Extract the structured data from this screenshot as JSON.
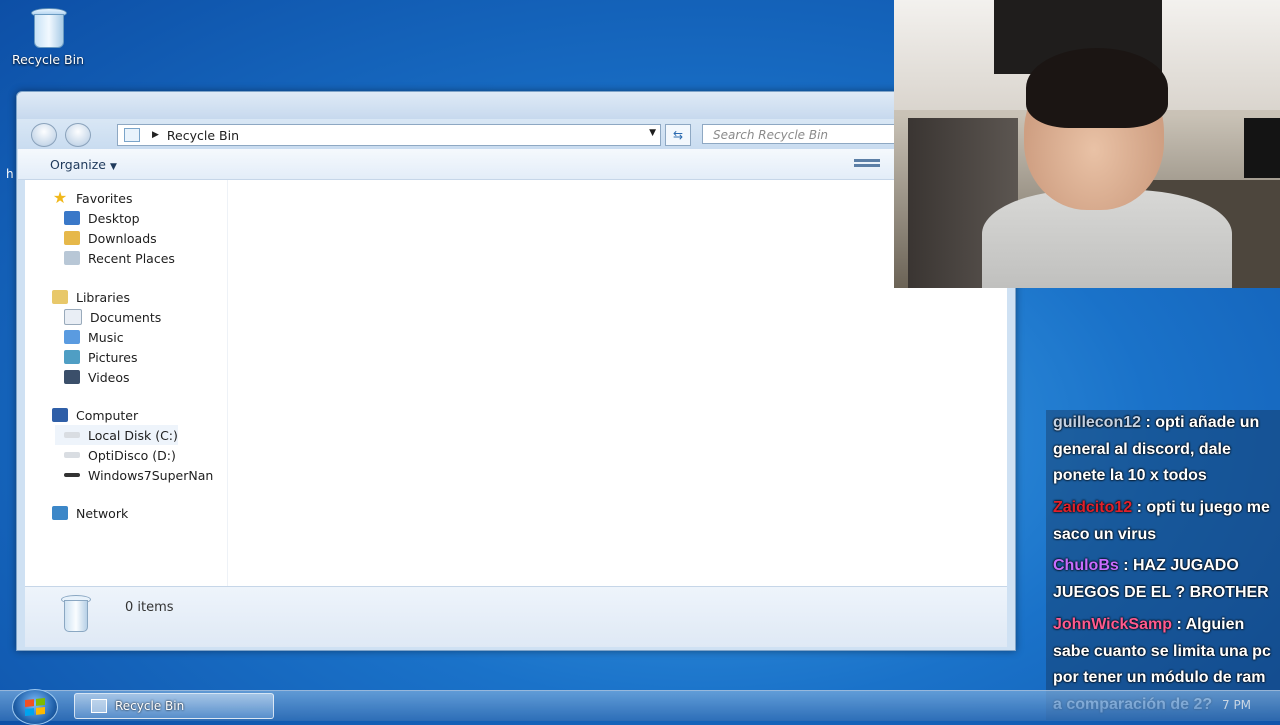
{
  "desktop": {
    "recycle_bin_label": "Recycle Bin",
    "edge_text": "h"
  },
  "window": {
    "address_path": "Recycle Bin",
    "search_placeholder": "Search Recycle Bin",
    "toolbar": {
      "organize_label": "Organize"
    },
    "nav": {
      "favorites": {
        "label": "Favorites",
        "items": [
          "Desktop",
          "Downloads",
          "Recent Places"
        ]
      },
      "libraries": {
        "label": "Libraries",
        "items": [
          "Documents",
          "Music",
          "Pictures",
          "Videos"
        ]
      },
      "computer": {
        "label": "Computer",
        "items": [
          "Local Disk (C:)",
          "OptiDisco (D:)",
          "Windows7SuperNan"
        ]
      },
      "network": {
        "label": "Network"
      }
    },
    "status": {
      "item_count": "0 items"
    }
  },
  "chat": {
    "messages": [
      {
        "user": "guillecon12",
        "user_color": "#c4d2e4",
        "text": "opti añade un general al discord, dale ponete la 10 x todos"
      },
      {
        "user": "Zaidcito12",
        "user_color": "#e0202a",
        "text": "opti tu juego me saco un virus"
      },
      {
        "user": "ChuloBs",
        "user_color": "#c86dff",
        "text": "HAZ JUGADO JUEGOS DE EL ? BROTHER"
      },
      {
        "user": "JohnWickSamp",
        "user_color": "#ff5a8e",
        "text": "Alguien sabe cuanto se limita una pc por tener un módulo de ram a comparación de 2?"
      }
    ]
  },
  "taskbar": {
    "task_label": "Recycle Bin",
    "clock": "7 PM"
  },
  "colors": {
    "accent": "#1e395b",
    "desktop_blue": "#1a72c9"
  },
  "icons": [
    "recycle-bin-icon",
    "star-icon",
    "library-icon",
    "computer-icon",
    "network-icon",
    "drive-icon",
    "start-orb-icon"
  ]
}
